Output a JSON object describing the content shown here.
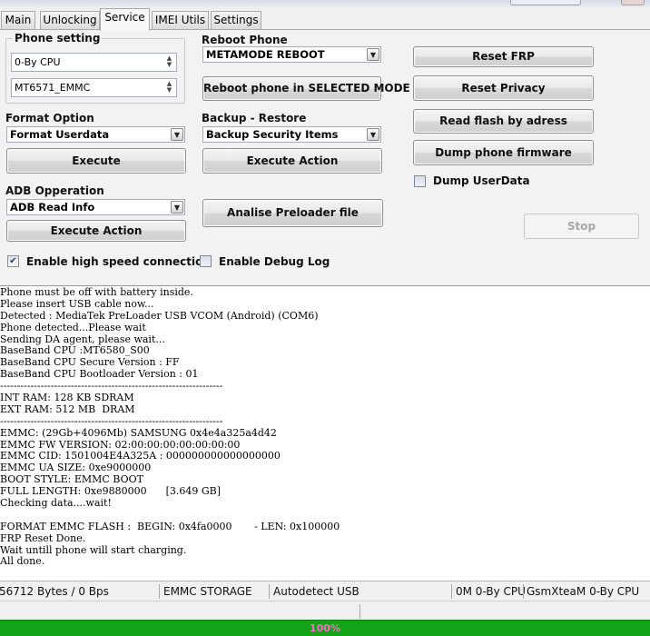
{
  "tabs": [
    {
      "label": "Main"
    },
    {
      "label": "Unlocking"
    },
    {
      "label": "Service"
    },
    {
      "label": "IMEI Utils"
    },
    {
      "label": "Settings"
    }
  ],
  "phone_setting": {
    "title": "Phone setting",
    "cpu_value": "0-By CPU",
    "model_value": "MT6571_EMMC"
  },
  "reboot": {
    "title": "Reboot Phone",
    "mode_value": "METAMODE REBOOT",
    "button": "Reboot phone in SELECTED MODE"
  },
  "format": {
    "title": "Format Option",
    "value": "Format Userdata",
    "button": "Execute"
  },
  "backup": {
    "title": "Backup - Restore",
    "value": "Backup Security Items",
    "button": "Execute Action"
  },
  "adb": {
    "title": "ADB Opperation",
    "value": "ADB Read Info",
    "button": "Execute Action"
  },
  "analise_button": "Analise Preloader file",
  "right_buttons": {
    "reset_frp": "Reset FRP",
    "reset_privacy": "Reset Privacy",
    "read_flash": "Read flash by adress",
    "dump_firmware": "Dump phone firmware",
    "stop": "Stop"
  },
  "checkboxes": {
    "dump_userdata": {
      "label": "Dump UserData",
      "checked": false
    },
    "high_speed": {
      "label": "Enable high speed connection",
      "checked": true
    },
    "debug_log": {
      "label": "Enable Debug Log",
      "checked": false
    }
  },
  "log_lines": [
    "Phone must be off with battery inside.",
    "Please insert USB cable now...",
    "Detected : MediaTek PreLoader USB VCOM (Android) (COM6)",
    "Phone detected...Please wait",
    "Sending DA agent, please wait...",
    "BaseBand CPU :MT6580_S00",
    "BaseBand CPU Secure Version : FF",
    "BaseBand CPU Bootloader Version : 01",
    "------------------------------------------------------------------",
    "INT RAM: 128 KB SDRAM",
    "EXT RAM: 512 MB  DRAM",
    "------------------------------------------------------------------",
    "EMMC: (29Gb+4096Mb) SAMSUNG 0x4e4a325a4d42",
    "EMMC FW VERSION: 02:00:00:00:00:00:00:00",
    "EMMC CID: 1501004E4A325A : 000000000000000000",
    "EMMC UA SIZE: 0xe9000000",
    "BOOT STYLE: EMMC BOOT",
    "FULL LENGTH: 0xe9880000      [3.649 GB]",
    "Checking data....wait!",
    "",
    "FORMAT EMMC FLASH :  BEGIN: 0x4fa0000       - LEN: 0x100000",
    "FRP Reset Done.",
    "Wait untill phone will start charging.",
    "All done."
  ],
  "status_bar": {
    "bytes": "56712 Bytes / 0 Bps",
    "storage": "EMMC STORAGE",
    "usb": "Autodetect USB",
    "cpu": "0M 0-By CPU",
    "user": "GsmXteaM 0-By CPU"
  },
  "progress": {
    "label": "100%",
    "value": 1.0
  },
  "colors": {
    "progress_fill": "#13a317",
    "progress_text": "#ff6ad0"
  }
}
